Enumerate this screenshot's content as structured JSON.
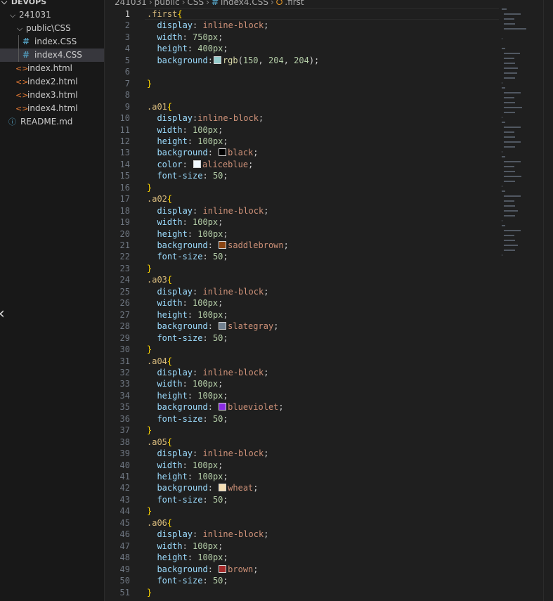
{
  "explorer": {
    "section_title": "DEVOPS",
    "items": [
      {
        "label": "241031",
        "kind": "folder-open",
        "depth": 0
      },
      {
        "label": "public\\CSS",
        "kind": "folder-open",
        "depth": 1
      },
      {
        "label": "index.CSS",
        "kind": "css",
        "depth": 2
      },
      {
        "label": "index4.CSS",
        "kind": "css",
        "depth": 2,
        "selected": true
      },
      {
        "label": "index.html",
        "kind": "html",
        "depth": 1
      },
      {
        "label": "index2.html",
        "kind": "html",
        "depth": 1
      },
      {
        "label": "index3.html",
        "kind": "html",
        "depth": 1
      },
      {
        "label": "index4.html",
        "kind": "html",
        "depth": 1
      },
      {
        "label": "README.md",
        "kind": "info",
        "depth": 0
      }
    ]
  },
  "breadcrumb": {
    "parts": [
      "241031",
      "public",
      "CSS"
    ],
    "file": "index4.CSS",
    "symbol": ".first"
  },
  "editor": {
    "current_line": 1,
    "lines": [
      {
        "n": 1,
        "t": [
          [
            "sel",
            ".first"
          ],
          [
            "br",
            "{"
          ]
        ]
      },
      {
        "n": 2,
        "t": [
          [
            "p",
            "  "
          ],
          [
            "prop",
            "display"
          ],
          [
            "p",
            ": "
          ],
          [
            "val",
            "inline-block"
          ],
          [
            "p",
            ";"
          ]
        ]
      },
      {
        "n": 3,
        "t": [
          [
            "p",
            "  "
          ],
          [
            "prop",
            "width"
          ],
          [
            "p",
            ": "
          ],
          [
            "num",
            "750px"
          ],
          [
            "p",
            ";"
          ]
        ]
      },
      {
        "n": 4,
        "t": [
          [
            "p",
            "  "
          ],
          [
            "prop",
            "height"
          ],
          [
            "p",
            ": "
          ],
          [
            "num",
            "400px"
          ],
          [
            "p",
            ";"
          ]
        ]
      },
      {
        "n": 5,
        "t": [
          [
            "p",
            "  "
          ],
          [
            "prop",
            "background"
          ],
          [
            "p",
            ":"
          ],
          [
            "sw",
            "#96cccc"
          ],
          [
            "fn",
            "rgb"
          ],
          [
            "p",
            "("
          ],
          [
            "num",
            "150"
          ],
          [
            "p",
            ", "
          ],
          [
            "num",
            "204"
          ],
          [
            "p",
            ", "
          ],
          [
            "num",
            "204"
          ],
          [
            "p",
            ");"
          ]
        ]
      },
      {
        "n": 6,
        "t": []
      },
      {
        "n": 7,
        "t": [
          [
            "br",
            "}"
          ]
        ]
      },
      {
        "n": 8,
        "t": []
      },
      {
        "n": 9,
        "t": [
          [
            "sel",
            ".a01"
          ],
          [
            "br",
            "{"
          ]
        ]
      },
      {
        "n": 10,
        "t": [
          [
            "p",
            "  "
          ],
          [
            "prop",
            "display"
          ],
          [
            "p",
            ":"
          ],
          [
            "val",
            "inline-block"
          ],
          [
            "p",
            ";"
          ]
        ]
      },
      {
        "n": 11,
        "t": [
          [
            "p",
            "  "
          ],
          [
            "prop",
            "width"
          ],
          [
            "p",
            ": "
          ],
          [
            "num",
            "100px"
          ],
          [
            "p",
            ";"
          ]
        ]
      },
      {
        "n": 12,
        "t": [
          [
            "p",
            "  "
          ],
          [
            "prop",
            "height"
          ],
          [
            "p",
            ": "
          ],
          [
            "num",
            "100px"
          ],
          [
            "p",
            ";"
          ]
        ]
      },
      {
        "n": 13,
        "t": [
          [
            "p",
            "  "
          ],
          [
            "prop",
            "background"
          ],
          [
            "p",
            ": "
          ],
          [
            "sw",
            "#000000"
          ],
          [
            "val",
            "black"
          ],
          [
            "p",
            ";"
          ]
        ]
      },
      {
        "n": 14,
        "t": [
          [
            "p",
            "  "
          ],
          [
            "prop",
            "color"
          ],
          [
            "p",
            ": "
          ],
          [
            "sw",
            "#f0f8ff"
          ],
          [
            "val",
            "aliceblue"
          ],
          [
            "p",
            ";"
          ]
        ]
      },
      {
        "n": 15,
        "t": [
          [
            "p",
            "  "
          ],
          [
            "prop",
            "font-size"
          ],
          [
            "p",
            ": "
          ],
          [
            "num",
            "50"
          ],
          [
            "p",
            ";"
          ]
        ]
      },
      {
        "n": 16,
        "t": [
          [
            "br",
            "}"
          ]
        ]
      },
      {
        "n": 17,
        "t": [
          [
            "sel",
            ".a02"
          ],
          [
            "br",
            "{"
          ]
        ]
      },
      {
        "n": 18,
        "t": [
          [
            "p",
            "  "
          ],
          [
            "prop",
            "display"
          ],
          [
            "p",
            ": "
          ],
          [
            "val",
            "inline-block"
          ],
          [
            "p",
            ";"
          ]
        ]
      },
      {
        "n": 19,
        "t": [
          [
            "p",
            "  "
          ],
          [
            "prop",
            "width"
          ],
          [
            "p",
            ": "
          ],
          [
            "num",
            "100px"
          ],
          [
            "p",
            ";"
          ]
        ]
      },
      {
        "n": 20,
        "t": [
          [
            "p",
            "  "
          ],
          [
            "prop",
            "height"
          ],
          [
            "p",
            ": "
          ],
          [
            "num",
            "100px"
          ],
          [
            "p",
            ";"
          ]
        ]
      },
      {
        "n": 21,
        "t": [
          [
            "p",
            "  "
          ],
          [
            "prop",
            "background"
          ],
          [
            "p",
            ": "
          ],
          [
            "sw",
            "#8b4513"
          ],
          [
            "val",
            "saddlebrown"
          ],
          [
            "p",
            ";"
          ]
        ]
      },
      {
        "n": 22,
        "t": [
          [
            "p",
            "  "
          ],
          [
            "prop",
            "font-size"
          ],
          [
            "p",
            ": "
          ],
          [
            "num",
            "50"
          ],
          [
            "p",
            ";"
          ]
        ]
      },
      {
        "n": 23,
        "t": [
          [
            "br",
            "}"
          ]
        ]
      },
      {
        "n": 24,
        "t": [
          [
            "sel",
            ".a03"
          ],
          [
            "br",
            "{"
          ]
        ]
      },
      {
        "n": 25,
        "t": [
          [
            "p",
            "  "
          ],
          [
            "prop",
            "display"
          ],
          [
            "p",
            ": "
          ],
          [
            "val",
            "inline-block"
          ],
          [
            "p",
            ";"
          ]
        ]
      },
      {
        "n": 26,
        "t": [
          [
            "p",
            "  "
          ],
          [
            "prop",
            "width"
          ],
          [
            "p",
            ": "
          ],
          [
            "num",
            "100px"
          ],
          [
            "p",
            ";"
          ]
        ]
      },
      {
        "n": 27,
        "t": [
          [
            "p",
            "  "
          ],
          [
            "prop",
            "height"
          ],
          [
            "p",
            ": "
          ],
          [
            "num",
            "100px"
          ],
          [
            "p",
            ";"
          ]
        ]
      },
      {
        "n": 28,
        "t": [
          [
            "p",
            "  "
          ],
          [
            "prop",
            "background"
          ],
          [
            "p",
            ": "
          ],
          [
            "sw",
            "#708090"
          ],
          [
            "val",
            "slategray"
          ],
          [
            "p",
            ";"
          ]
        ]
      },
      {
        "n": 29,
        "t": [
          [
            "p",
            "  "
          ],
          [
            "prop",
            "font-size"
          ],
          [
            "p",
            ": "
          ],
          [
            "num",
            "50"
          ],
          [
            "p",
            ";"
          ]
        ]
      },
      {
        "n": 30,
        "t": [
          [
            "br",
            "}"
          ]
        ]
      },
      {
        "n": 31,
        "t": [
          [
            "sel",
            ".a04"
          ],
          [
            "br",
            "{"
          ]
        ]
      },
      {
        "n": 32,
        "t": [
          [
            "p",
            "  "
          ],
          [
            "prop",
            "display"
          ],
          [
            "p",
            ": "
          ],
          [
            "val",
            "inline-block"
          ],
          [
            "p",
            ";"
          ]
        ]
      },
      {
        "n": 33,
        "t": [
          [
            "p",
            "  "
          ],
          [
            "prop",
            "width"
          ],
          [
            "p",
            ": "
          ],
          [
            "num",
            "100px"
          ],
          [
            "p",
            ";"
          ]
        ]
      },
      {
        "n": 34,
        "t": [
          [
            "p",
            "  "
          ],
          [
            "prop",
            "height"
          ],
          [
            "p",
            ": "
          ],
          [
            "num",
            "100px"
          ],
          [
            "p",
            ";"
          ]
        ]
      },
      {
        "n": 35,
        "t": [
          [
            "p",
            "  "
          ],
          [
            "prop",
            "background"
          ],
          [
            "p",
            ": "
          ],
          [
            "sw",
            "#8a2be2"
          ],
          [
            "val",
            "blueviolet"
          ],
          [
            "p",
            ";"
          ]
        ]
      },
      {
        "n": 36,
        "t": [
          [
            "p",
            "  "
          ],
          [
            "prop",
            "font-size"
          ],
          [
            "p",
            ": "
          ],
          [
            "num",
            "50"
          ],
          [
            "p",
            ";"
          ]
        ]
      },
      {
        "n": 37,
        "t": [
          [
            "br",
            "}"
          ]
        ]
      },
      {
        "n": 38,
        "t": [
          [
            "sel",
            ".a05"
          ],
          [
            "br",
            "{"
          ]
        ]
      },
      {
        "n": 39,
        "t": [
          [
            "p",
            "  "
          ],
          [
            "prop",
            "display"
          ],
          [
            "p",
            ": "
          ],
          [
            "val",
            "inline-block"
          ],
          [
            "p",
            ";"
          ]
        ]
      },
      {
        "n": 40,
        "t": [
          [
            "p",
            "  "
          ],
          [
            "prop",
            "width"
          ],
          [
            "p",
            ": "
          ],
          [
            "num",
            "100px"
          ],
          [
            "p",
            ";"
          ]
        ]
      },
      {
        "n": 41,
        "t": [
          [
            "p",
            "  "
          ],
          [
            "prop",
            "height"
          ],
          [
            "p",
            ": "
          ],
          [
            "num",
            "100px"
          ],
          [
            "p",
            ";"
          ]
        ]
      },
      {
        "n": 42,
        "t": [
          [
            "p",
            "  "
          ],
          [
            "prop",
            "background"
          ],
          [
            "p",
            ": "
          ],
          [
            "sw",
            "#f5deb3"
          ],
          [
            "val",
            "wheat"
          ],
          [
            "p",
            ";"
          ]
        ]
      },
      {
        "n": 43,
        "t": [
          [
            "p",
            "  "
          ],
          [
            "prop",
            "font-size"
          ],
          [
            "p",
            ": "
          ],
          [
            "num",
            "50"
          ],
          [
            "p",
            ";"
          ]
        ]
      },
      {
        "n": 44,
        "t": [
          [
            "br",
            "}"
          ]
        ]
      },
      {
        "n": 45,
        "t": [
          [
            "sel",
            ".a06"
          ],
          [
            "br",
            "{"
          ]
        ]
      },
      {
        "n": 46,
        "t": [
          [
            "p",
            "  "
          ],
          [
            "prop",
            "display"
          ],
          [
            "p",
            ": "
          ],
          [
            "val",
            "inline-block"
          ],
          [
            "p",
            ";"
          ]
        ]
      },
      {
        "n": 47,
        "t": [
          [
            "p",
            "  "
          ],
          [
            "prop",
            "width"
          ],
          [
            "p",
            ": "
          ],
          [
            "num",
            "100px"
          ],
          [
            "p",
            ";"
          ]
        ]
      },
      {
        "n": 48,
        "t": [
          [
            "p",
            "  "
          ],
          [
            "prop",
            "height"
          ],
          [
            "p",
            ": "
          ],
          [
            "num",
            "100px"
          ],
          [
            "p",
            ";"
          ]
        ]
      },
      {
        "n": 49,
        "t": [
          [
            "p",
            "  "
          ],
          [
            "prop",
            "background"
          ],
          [
            "p",
            ": "
          ],
          [
            "sw",
            "#a52a2a"
          ],
          [
            "val",
            "brown"
          ],
          [
            "p",
            ";"
          ]
        ]
      },
      {
        "n": 50,
        "t": [
          [
            "p",
            "  "
          ],
          [
            "prop",
            "font-size"
          ],
          [
            "p",
            ": "
          ],
          [
            "num",
            "50"
          ],
          [
            "p",
            ";"
          ]
        ]
      },
      {
        "n": 51,
        "t": [
          [
            "br",
            "}"
          ]
        ]
      }
    ]
  }
}
